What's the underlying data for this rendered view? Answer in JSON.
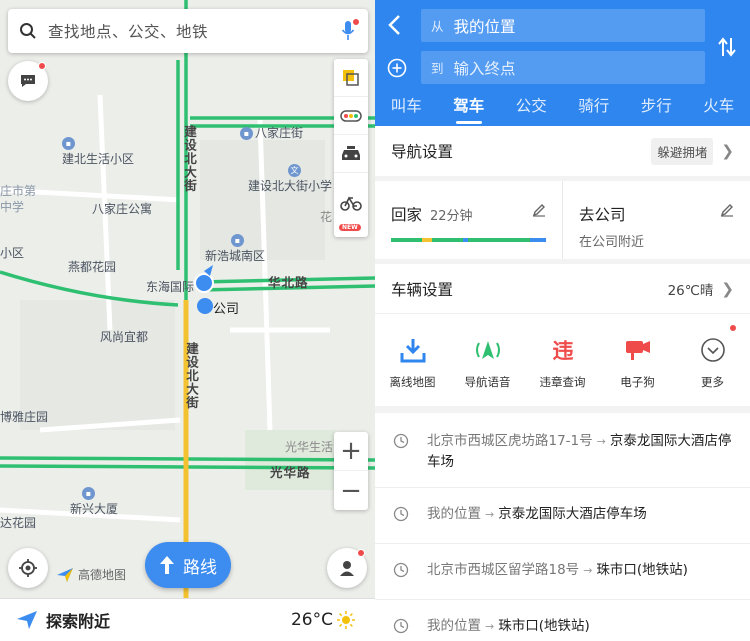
{
  "map": {
    "search_placeholder": "查找地点、公交、地铁",
    "labels": {
      "jianshe_north_top": "建设北大街",
      "jianshe_north_bottom": "建设北大街",
      "bajiazhuang_alley": "八家庄街",
      "jiansheb_community": "建北生活小区",
      "bajiazhuang_apartment": "八家庄公寓",
      "school": "建设北大街小学",
      "xinhao_south": "新浩城南区",
      "yandu_garden": "燕都花园",
      "donghai": "东海国际",
      "huabei_road": "华北路",
      "company": "公司",
      "fengshang": "风尚宜都",
      "boya": "博雅庄园",
      "guanghua_life": "光华生活",
      "guanghua_road": "光华路",
      "xinxing": "新兴大厦",
      "da_garden": "达花园",
      "left_edge_a": "庄市第",
      "left_edge_b": "中学",
      "left_edge_c": "小区",
      "flower": "花",
      "amap_logo": "高德地图"
    },
    "route_button": "路线",
    "explore": "探索附近",
    "weather": "26°C"
  },
  "panel": {
    "from_prefix": "从",
    "from_value": "我的位置",
    "to_prefix": "到",
    "to_placeholder": "输入终点",
    "tabs": [
      "叫车",
      "驾车",
      "公交",
      "骑行",
      "步行",
      "火车"
    ],
    "active_tab": "驾车",
    "nav_settings": {
      "title": "导航设置",
      "option": "躲避拥堵"
    },
    "home": {
      "name": "回家",
      "time": "22分钟"
    },
    "work": {
      "name": "去公司",
      "sub": "在公司附近"
    },
    "vehicle": {
      "title": "车辆设置",
      "value": "26℃晴"
    },
    "tools": [
      {
        "label": "离线地图",
        "icon": "download-icon"
      },
      {
        "label": "导航语音",
        "icon": "voice-nav-icon"
      },
      {
        "label": "违章查询",
        "icon": "violation-icon"
      },
      {
        "label": "电子狗",
        "icon": "camera-icon"
      },
      {
        "label": "更多",
        "icon": "more-icon"
      }
    ],
    "history": [
      {
        "from": "北京市西城区虎坊路17-1号",
        "to": "京泰龙国际大酒店停车场"
      },
      {
        "from": "我的位置",
        "to": "京泰龙国际大酒店停车场"
      },
      {
        "from": "北京市西城区留学路18号",
        "to": "珠市口(地铁站)"
      },
      {
        "from": "我的位置",
        "to": "珠市口(地铁站)"
      }
    ]
  },
  "colors": {
    "brand_blue": "#2f86ef",
    "road_green": "#2fbf71",
    "road_yellow": "#f2c230",
    "badge_red": "#f04b4b"
  }
}
